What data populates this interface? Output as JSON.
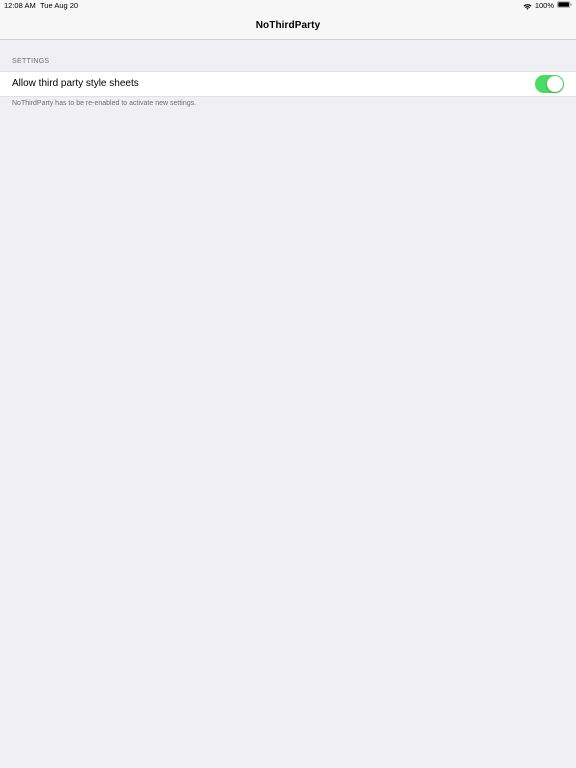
{
  "status_bar": {
    "time": "12:08 AM",
    "date": "Tue Aug 20",
    "battery": "100%",
    "wifi_icon": "wifi-icon",
    "battery_icon": "battery-icon"
  },
  "nav": {
    "title": "NoThirdParty"
  },
  "settings": {
    "section_header": "SETTINGS",
    "rows": [
      {
        "label": "Allow third party style sheets",
        "toggle_on": true
      }
    ],
    "footer": "NoThirdParty has to be re-enabled to activate new settings."
  },
  "colors": {
    "background": "#efeff4",
    "toggle_on": "#4cd964",
    "secondary_text": "#6d6d72"
  }
}
